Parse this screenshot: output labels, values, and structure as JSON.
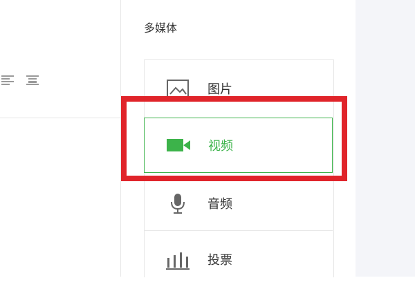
{
  "panel": {
    "title": "多媒体"
  },
  "menu": {
    "items": [
      {
        "label": "图片",
        "icon": "image-icon"
      },
      {
        "label": "视频",
        "icon": "video-camera-icon",
        "selected": true
      },
      {
        "label": "音频",
        "icon": "microphone-icon"
      },
      {
        "label": "投票",
        "icon": "bar-chart-icon"
      }
    ]
  },
  "colors": {
    "accent": "#3cb34a",
    "annotation": "#e0242a",
    "text": "#333333",
    "icon_gray": "#666666"
  }
}
